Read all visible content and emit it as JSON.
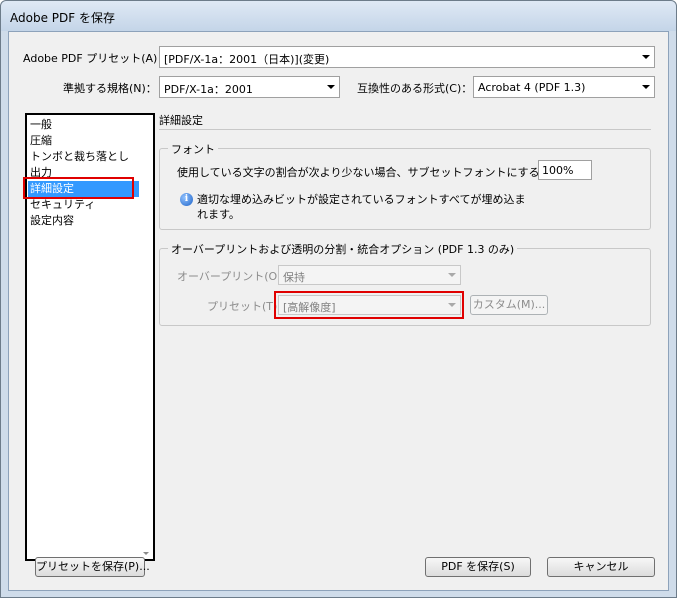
{
  "window": {
    "title": "Adobe PDF を保存"
  },
  "preset": {
    "label": "Adobe PDF プリセット(A)：",
    "value": "[PDF/X-1a：2001（日本)](変更)"
  },
  "standard": {
    "label": "準拠する規格(N)：",
    "value": "PDF/X-1a：2001"
  },
  "compat": {
    "label": "互換性のある形式(C)：",
    "value": "Acrobat 4 (PDF 1.3)"
  },
  "sidebar": {
    "items": [
      {
        "label": "一般"
      },
      {
        "label": "圧縮"
      },
      {
        "label": "トンボと裁ち落とし"
      },
      {
        "label": "出力"
      },
      {
        "label": "詳細設定",
        "selected": true
      },
      {
        "label": "セキュリティ"
      },
      {
        "label": "設定内容"
      }
    ]
  },
  "section": {
    "title": "詳細設定"
  },
  "font_group": {
    "legend": "フォント",
    "subset_label": "使用している文字の割合が次より少ない場合、サブセットフォントにする(W)：",
    "subset_value": "100%",
    "info_text_line1": "適切な埋め込みビットが設定されているフォントすべてが埋め込ま",
    "info_text_line2": "れます。"
  },
  "overprint_group": {
    "legend": "オーバープリントおよび透明の分割・統合オプション (PDF 1.3 のみ)",
    "overprint_label": "オーバープリント(O)：",
    "overprint_value": "保持",
    "preset_label": "プリセット(T)：",
    "preset_value": "[高解像度]",
    "custom_button": "カスタム(M)..."
  },
  "buttons": {
    "save_preset": "プリセットを保存(P)...",
    "save_pdf": "PDF を保存(S)",
    "cancel": "キャンセル"
  },
  "colors": {
    "highlight": "#e00000",
    "selection": "#3399ff"
  }
}
